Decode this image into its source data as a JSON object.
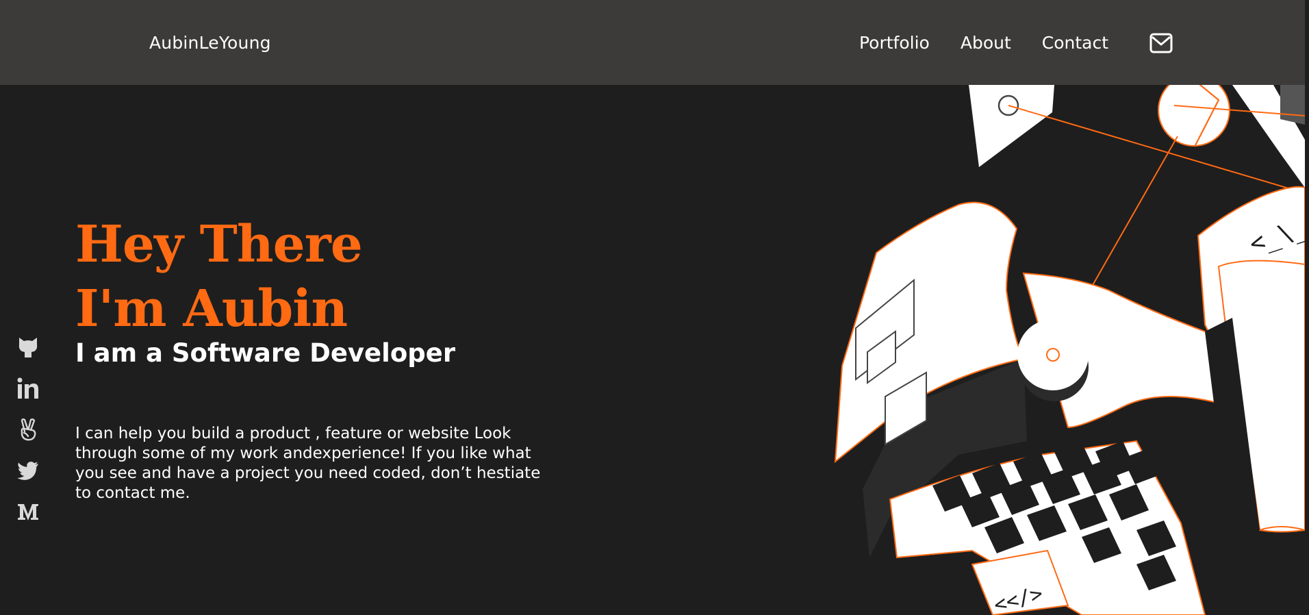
{
  "header": {
    "brand": "AubinLeYoung",
    "nav": [
      "Portfolio",
      "About",
      "Contact"
    ],
    "mail_icon": "mail-icon"
  },
  "hero": {
    "title_line1": "Hey There",
    "title_line2": "I'm Aubin",
    "subtitle": "I am a Software Developer",
    "bio": "I can help you build a product , feature or website Look through some of my work andexperience! If you like what you see and have a project you need coded, don’t hestiate to contact me."
  },
  "social_icons": [
    "github-icon",
    "linkedin-icon",
    "angellist-icon",
    "twitter-icon",
    "medium-icon"
  ],
  "illustration": {
    "code_tag_top": "<_\\_",
    "code_tag_bottom": "<</>"
  },
  "colors": {
    "accent": "#ff6a13",
    "background": "#1e1e1e",
    "header": "#3c3b3a",
    "text": "#ffffff",
    "icon": "#d9d9d9"
  }
}
